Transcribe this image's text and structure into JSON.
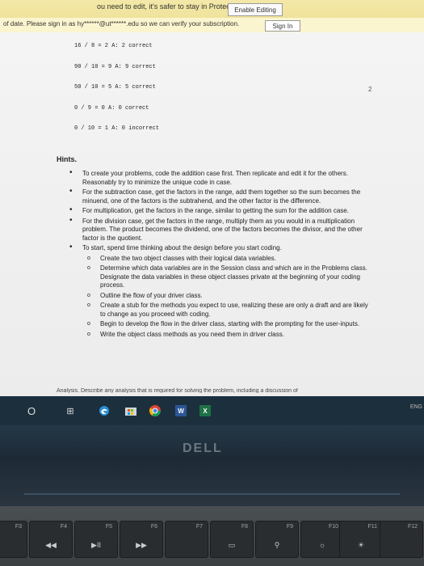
{
  "protected_view": {
    "message": "ou need to edit, it's safer to stay in Protected View.",
    "enable_button": "Enable Editing"
  },
  "subscription": {
    "message": "of date. Please sign in as hy******@ut******.edu so we can verify your subscription.",
    "sign_in_button": "Sign In"
  },
  "document": {
    "code_lines": [
      "16 / 8 = 2 A: 2 correct",
      "90 / 10 = 9 A: 9 correct",
      "50 / 10 = 5 A: 5 correct",
      "0 / 9 = 0 A: 0 correct",
      "0 / 10 = 1 A: 0 incorrect"
    ],
    "page_number": "2",
    "hints_title": "Hints.",
    "hints": [
      "To create your problems, code the addition case first. Then replicate and edit it for the others. Reasonably try to minimize the unique code in case.",
      "For the subtraction case, get the factors in the range, add them together so the sum becomes the minuend, one of the factors is the subtrahend, and the other factor is the difference.",
      "For multiplication, get the factors in the range, similar to getting the sum for the addition case.",
      "For the division case, get the factors in the range, multiply them as you would in a multiplication problem. The product becomes the dividend, one of the factors becomes the divisor, and the other factor is the quotient.",
      "To start, spend time thinking about the design before you start coding."
    ],
    "subhints": [
      "Create the two object classes with their logical data variables.",
      "Determine which data variables are in the Session class and which are in the Problems class. Designate the data variables in these object classes private at the beginning of your coding process.",
      "Outline the flow of your driver class.",
      "Create a stub for the methods you expect to use, realizing these are only a draft and are likely to change as you proceed with coding.",
      "Begin to develop the flow in the driver class, starting with the prompting for the user-inputs.",
      "Write the object class methods as you need them in driver class."
    ],
    "cut_line": "Analysis. Describe any analysis that is required for solving the problem, including a discussion of"
  },
  "taskbar": {
    "search_glyph": "O",
    "task_view_glyph": "⊞",
    "word_letter": "W",
    "excel_letter": "X",
    "tray_text": "ENG"
  },
  "laptop": {
    "brand": "DELL"
  },
  "keyboard": {
    "keys": [
      {
        "label": "F3",
        "glyph": ""
      },
      {
        "label": "F4",
        "glyph": "◀◀"
      },
      {
        "label": "F5",
        "glyph": "▶II"
      },
      {
        "label": "F6",
        "glyph": "▶▶"
      },
      {
        "label": "F7",
        "glyph": ""
      },
      {
        "label": "F8",
        "glyph": "▭"
      },
      {
        "label": "F9",
        "glyph": "⚲"
      },
      {
        "label": "F10",
        "glyph": "☼"
      },
      {
        "label": "F11",
        "glyph": "☀"
      },
      {
        "label": "F12",
        "glyph": ""
      }
    ]
  },
  "colors": {
    "protected_bar": "#f3e8a8",
    "taskbar": "#1c2f3d",
    "word": "#2b5797",
    "excel": "#1e7145"
  }
}
